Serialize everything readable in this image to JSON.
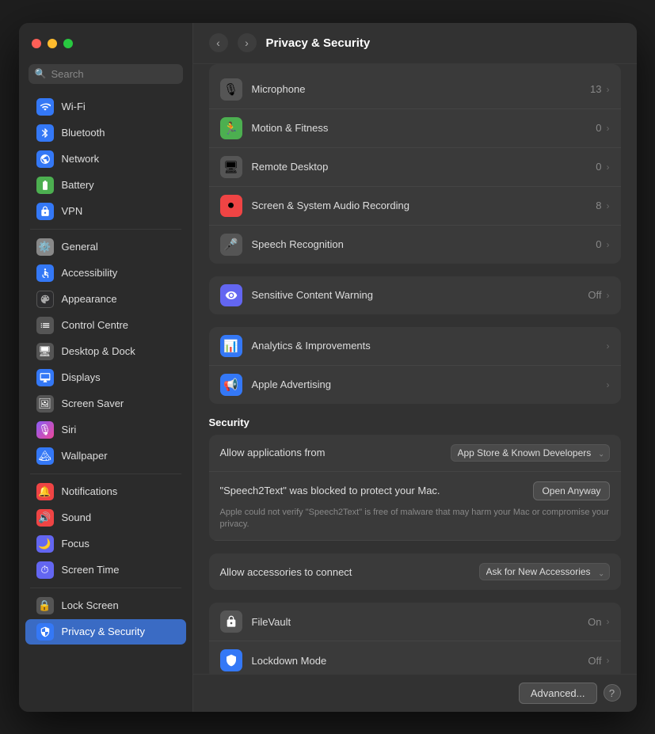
{
  "window": {
    "title": "Privacy & Security"
  },
  "sidebar": {
    "search_placeholder": "Search",
    "groups": [
      {
        "items": [
          {
            "id": "wifi",
            "label": "Wi-Fi",
            "icon": "📶",
            "icon_class": "icon-wifi"
          },
          {
            "id": "bluetooth",
            "label": "Bluetooth",
            "icon": "🔵",
            "icon_class": "icon-bluetooth"
          },
          {
            "id": "network",
            "label": "Network",
            "icon": "🌐",
            "icon_class": "icon-network"
          },
          {
            "id": "battery",
            "label": "Battery",
            "icon": "🔋",
            "icon_class": "icon-battery"
          },
          {
            "id": "vpn",
            "label": "VPN",
            "icon": "🔒",
            "icon_class": "icon-vpn"
          }
        ]
      },
      {
        "items": [
          {
            "id": "general",
            "label": "General",
            "icon": "⚙️",
            "icon_class": "icon-general"
          },
          {
            "id": "accessibility",
            "label": "Accessibility",
            "icon": "♿",
            "icon_class": "icon-accessibility"
          },
          {
            "id": "appearance",
            "label": "Appearance",
            "icon": "🎨",
            "icon_class": "icon-appearance"
          },
          {
            "id": "controlcentre",
            "label": "Control Centre",
            "icon": "⊞",
            "icon_class": "icon-controlcentre"
          },
          {
            "id": "desktopdock",
            "label": "Desktop & Dock",
            "icon": "🖥",
            "icon_class": "icon-desktopdock"
          },
          {
            "id": "displays",
            "label": "Displays",
            "icon": "💻",
            "icon_class": "icon-displays"
          },
          {
            "id": "screensaver",
            "label": "Screen Saver",
            "icon": "🖼",
            "icon_class": "icon-screensaver"
          },
          {
            "id": "siri",
            "label": "Siri",
            "icon": "🎙",
            "icon_class": "icon-siri"
          },
          {
            "id": "wallpaper",
            "label": "Wallpaper",
            "icon": "🏔",
            "icon_class": "icon-wallpaper"
          }
        ]
      },
      {
        "items": [
          {
            "id": "notifications",
            "label": "Notifications",
            "icon": "🔔",
            "icon_class": "icon-notifications"
          },
          {
            "id": "sound",
            "label": "Sound",
            "icon": "🔊",
            "icon_class": "icon-sound"
          },
          {
            "id": "focus",
            "label": "Focus",
            "icon": "🌙",
            "icon_class": "icon-focus"
          },
          {
            "id": "screentime",
            "label": "Screen Time",
            "icon": "⏱",
            "icon_class": "icon-screentime"
          }
        ]
      },
      {
        "items": [
          {
            "id": "lockscreen",
            "label": "Lock Screen",
            "icon": "🔒",
            "icon_class": "icon-lockscreen"
          },
          {
            "id": "privacy",
            "label": "Privacy & Security",
            "icon": "🔐",
            "icon_class": "icon-privacy",
            "active": true
          }
        ]
      }
    ]
  },
  "main": {
    "title": "Privacy & Security",
    "settings_rows": [
      {
        "id": "microphone",
        "label": "Microphone",
        "value": "13",
        "icon": "🎙",
        "icon_class": "icon-mic"
      },
      {
        "id": "motion",
        "label": "Motion & Fitness",
        "value": "0",
        "icon": "🏃",
        "icon_class": "icon-motion"
      },
      {
        "id": "remote",
        "label": "Remote Desktop",
        "value": "0",
        "icon": "🖥",
        "icon_class": "icon-remote"
      },
      {
        "id": "screenrec",
        "label": "Screen & System Audio Recording",
        "value": "8",
        "icon": "⏺",
        "icon_class": "icon-screen-rec"
      },
      {
        "id": "speech",
        "label": "Speech Recognition",
        "value": "0",
        "icon": "🎤",
        "icon_class": "icon-speech"
      }
    ],
    "standalone_rows": [
      {
        "id": "sensitive",
        "label": "Sensitive Content Warning",
        "value": "Off",
        "icon": "👁",
        "icon_class": "icon-sensitive"
      },
      {
        "id": "analytics",
        "label": "Analytics & Improvements",
        "value": "",
        "icon": "📊",
        "icon_class": "icon-analytics"
      },
      {
        "id": "advertising",
        "label": "Apple Advertising",
        "value": "",
        "icon": "📢",
        "icon_class": "icon-advertising"
      }
    ],
    "security_section": {
      "header": "Security",
      "allow_apps_label": "Allow applications from",
      "allow_apps_value": "App Store & Known Developers",
      "blocked_text": "\"Speech2Text\" was blocked to protect your Mac.",
      "open_anyway_label": "Open Anyway",
      "blocked_sub": "Apple could not verify \"Speech2Text\" is free of malware that may harm your Mac or compromise your privacy.",
      "accessories_label": "Allow accessories to connect",
      "accessories_value": "Ask for New Accessories",
      "filevault_label": "FileVault",
      "filevault_value": "On",
      "lockdown_label": "Lockdown Mode",
      "lockdown_value": "Off"
    },
    "bottom": {
      "advanced_label": "Advanced...",
      "help_label": "?"
    }
  }
}
